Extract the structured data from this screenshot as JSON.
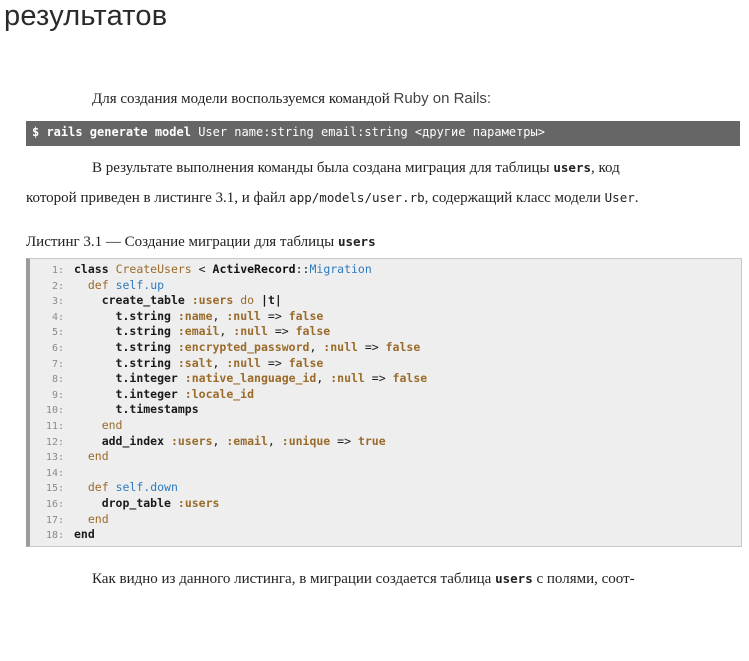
{
  "heading": "результатов",
  "intro": {
    "text": "Для создания модели воспользуемся командой",
    "tail": "Ruby on Rails:"
  },
  "command": {
    "bold": "$ rails generate model",
    "rest": "User name:string email:string <другие параметры>"
  },
  "para2": {
    "line1_a": "В результате выполнения команды была создана миграция для таблицы",
    "line1_code": "users",
    "line1_b": ", код",
    "line2_a": "которой приведен в листинге 3.1, и файл",
    "line2_code": "app/models/user.rb",
    "line2_b": ", содержащий класс модели",
    "line2_code2": "User",
    "line2_c": "."
  },
  "listing": {
    "title_a": "Листинг 3.1 — Создание миграции для таблицы",
    "title_code": "users",
    "line_numbers": [
      "1:",
      "2:",
      "3:",
      "4:",
      "5:",
      "6:",
      "7:",
      "8:",
      "9:",
      "10:",
      "11:",
      "12:",
      "13:",
      "14:",
      "15:",
      "16:",
      "17:",
      "18:"
    ]
  },
  "final_para": {
    "a": "Как видно из данного листинга, в миграции создается таблица",
    "code": "users",
    "b": "с полями, соот-"
  }
}
